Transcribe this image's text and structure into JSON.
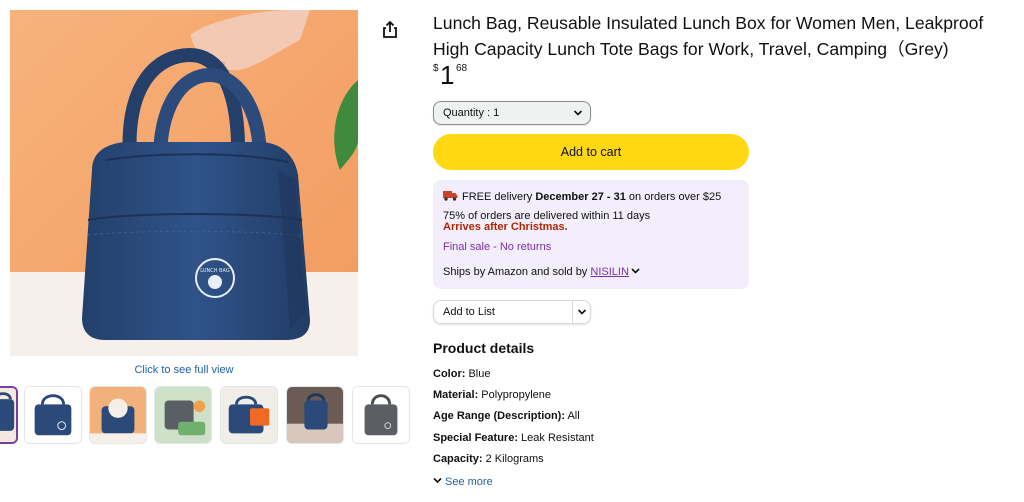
{
  "product": {
    "title": "Lunch Bag, Reusable Insulated Lunch Box for Women Men, Leakproof High Capacity Lunch Tote Bags for Work, Travel, Camping（Grey)",
    "price": {
      "symbol": "$",
      "whole": "1",
      "fraction": "68"
    }
  },
  "gallery": {
    "full_view_label": "Click to see full view",
    "bag_logo_text": "LUNCH BAG",
    "thumbnail_count": 7,
    "selected_thumbnail": 1
  },
  "actions": {
    "quantity_label": "Quantity : 1",
    "add_to_cart": "Add to cart",
    "add_to_list": "Add to List",
    "share_icon": "share-icon"
  },
  "delivery": {
    "free_prefix": "FREE delivery ",
    "dates": "December 27 - 31",
    "free_suffix": " on orders over $25",
    "percent_note": "75% of orders are delivered within 11 days",
    "arrival_note": "Arrives after Christmas.",
    "final_sale": "Final sale - No returns",
    "ships_prefix": "Ships by Amazon and sold by ",
    "seller": "NISILIN"
  },
  "details": {
    "heading": "Product details",
    "specs": [
      {
        "label": "Color:",
        "value": " Blue"
      },
      {
        "label": "Material:",
        "value": " Polypropylene"
      },
      {
        "label": "Age Range (Description):",
        "value": " All"
      },
      {
        "label": "Special Feature:",
        "value": " Leak Resistant"
      },
      {
        "label": "Capacity:",
        "value": " 2 Kilograms"
      }
    ],
    "see_more": "See more"
  },
  "colors": {
    "cart_button": "#ffd814",
    "delivery_bg": "#f3eefb",
    "link": "#2162a1",
    "alert": "#b12704",
    "bag_navy": "#2b4a7a"
  }
}
